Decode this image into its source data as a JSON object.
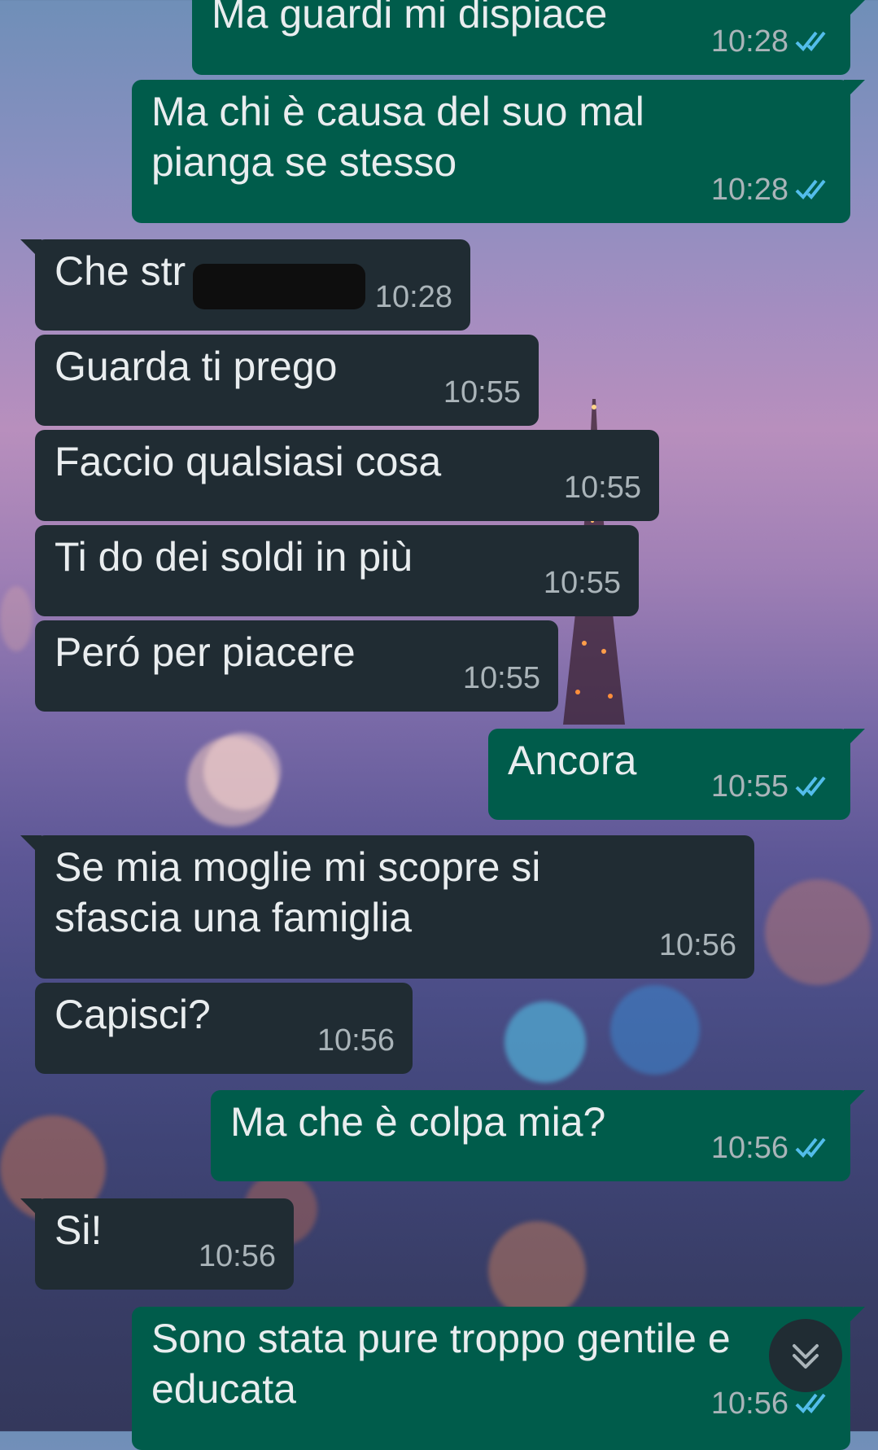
{
  "messages": [
    {
      "dir": "out",
      "text": "Ma guardi mi dispiace",
      "time": "10:28",
      "ticks": "double-check-blue"
    },
    {
      "dir": "out",
      "text": "Ma chi è causa del suo mal\npianga se stesso",
      "time": "10:28",
      "ticks": "double-check-blue"
    },
    {
      "dir": "in",
      "text": "Che str",
      "time": "10:28",
      "redacted": true
    },
    {
      "dir": "in",
      "text": "Guarda ti prego",
      "time": "10:55"
    },
    {
      "dir": "in",
      "text": "Faccio qualsiasi cosa",
      "time": "10:55"
    },
    {
      "dir": "in",
      "text": "Ti do dei soldi in più",
      "time": "10:55"
    },
    {
      "dir": "in",
      "text": "Peró per piacere",
      "time": "10:55"
    },
    {
      "dir": "out",
      "text": "Ancora",
      "time": "10:55",
      "ticks": "double-check-blue"
    },
    {
      "dir": "in",
      "text": "Se mia moglie mi scopre si\nsfascia una famiglia",
      "time": "10:56"
    },
    {
      "dir": "in",
      "text": "Capisci?",
      "time": "10:56"
    },
    {
      "dir": "out",
      "text": "Ma che è colpa mia?",
      "time": "10:56",
      "ticks": "double-check-blue"
    },
    {
      "dir": "in",
      "text": "Si!",
      "time": "10:56"
    },
    {
      "dir": "out",
      "text": "Sono stata pure troppo gentile e\neducata",
      "time": "10:56",
      "ticks": "double-check-blue"
    }
  ],
  "scroll_down_button": {
    "icon": "chevron-double-down-icon"
  },
  "colors": {
    "outgoing": "#005c4b",
    "incoming": "#202c33",
    "read_ticks": "#53bdeb",
    "text": "#e9edef",
    "time": "#aab4b9"
  }
}
